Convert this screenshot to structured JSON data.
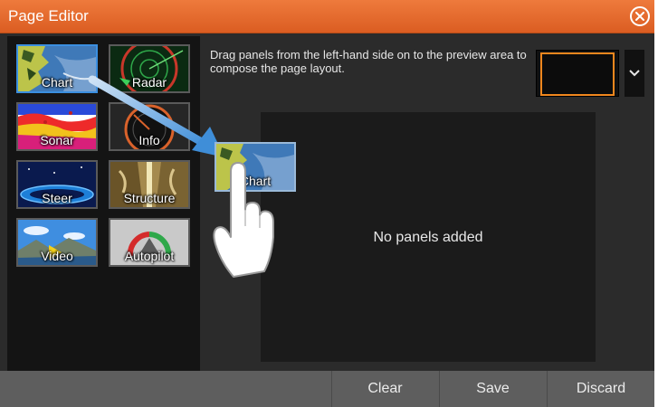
{
  "window": {
    "title": "Page Editor"
  },
  "panels": [
    {
      "id": "chart",
      "label": "Chart",
      "selected": true
    },
    {
      "id": "radar",
      "label": "Radar",
      "selected": false
    },
    {
      "id": "sonar",
      "label": "Sonar",
      "selected": false
    },
    {
      "id": "info",
      "label": "Info",
      "selected": false
    },
    {
      "id": "steer",
      "label": "Steer",
      "selected": false
    },
    {
      "id": "structure",
      "label": "Structure",
      "selected": false
    },
    {
      "id": "video",
      "label": "Video",
      "selected": false
    },
    {
      "id": "autopilot",
      "label": "Autopilot",
      "selected": false
    }
  ],
  "instructions": "Drag panels from the left-hand side on to the preview area to compose the page layout.",
  "preview": {
    "empty_text": "No panels added"
  },
  "dragging": {
    "label": "Chart"
  },
  "footer": {
    "clear": "Clear",
    "save": "Save",
    "discard": "Discard"
  },
  "colors": {
    "title_bar": "#e36a2c",
    "selected_border": "#3b8fe0",
    "layout_highlight": "#f0871e",
    "footer": "#5e5e5e"
  },
  "icons": {
    "close": "close-circle-icon",
    "layout_dropdown": "chevron-down-icon",
    "pointer": "hand-pointer-icon"
  }
}
